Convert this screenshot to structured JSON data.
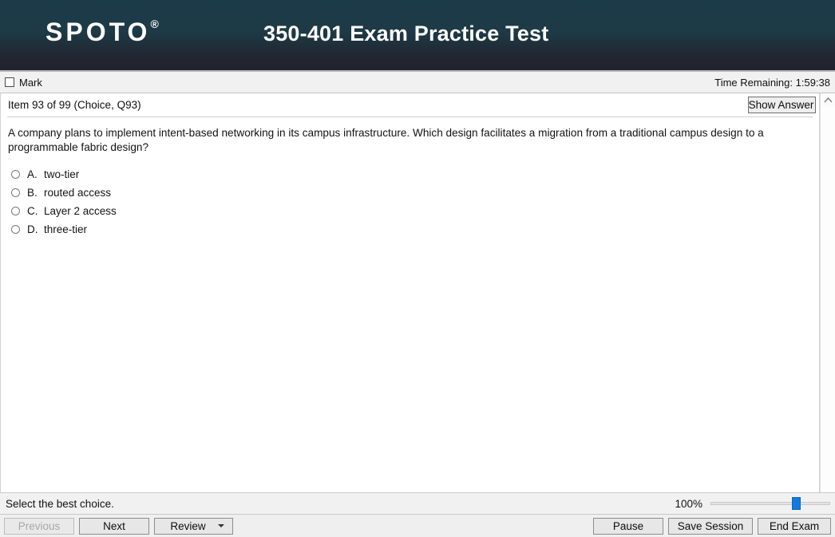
{
  "header": {
    "logo": "SPOTO",
    "logo_mark": "®",
    "title": "350-401 Exam Practice Test"
  },
  "markbar": {
    "mark_label": "Mark",
    "timer": "Time Remaining: 1:59:38"
  },
  "item": {
    "label": "Item 93 of 99  (Choice, Q93)",
    "show_answer_label": "Show Answer"
  },
  "question": {
    "text": "A company plans to implement intent-based networking in its campus infrastructure. Which design facilitates a migration from a traditional campus design to a programmable fabric design?"
  },
  "choices": [
    {
      "letter": "A.",
      "text": "two-tier"
    },
    {
      "letter": "B.",
      "text": "routed access"
    },
    {
      "letter": "C.",
      "text": "Layer 2 access"
    },
    {
      "letter": "D.",
      "text": "three-tier"
    }
  ],
  "status": {
    "hint": "Select the best choice.",
    "zoom_level": "100%"
  },
  "buttons": {
    "previous": "Previous",
    "next": "Next",
    "review": "Review",
    "pause": "Pause",
    "save_session": "Save Session",
    "end_exam": "End Exam"
  },
  "colors": {
    "header_top": "#1c3b48",
    "header_bottom": "#21242e",
    "slider_thumb": "#1478e0",
    "chrome": "#f1f1f1"
  }
}
